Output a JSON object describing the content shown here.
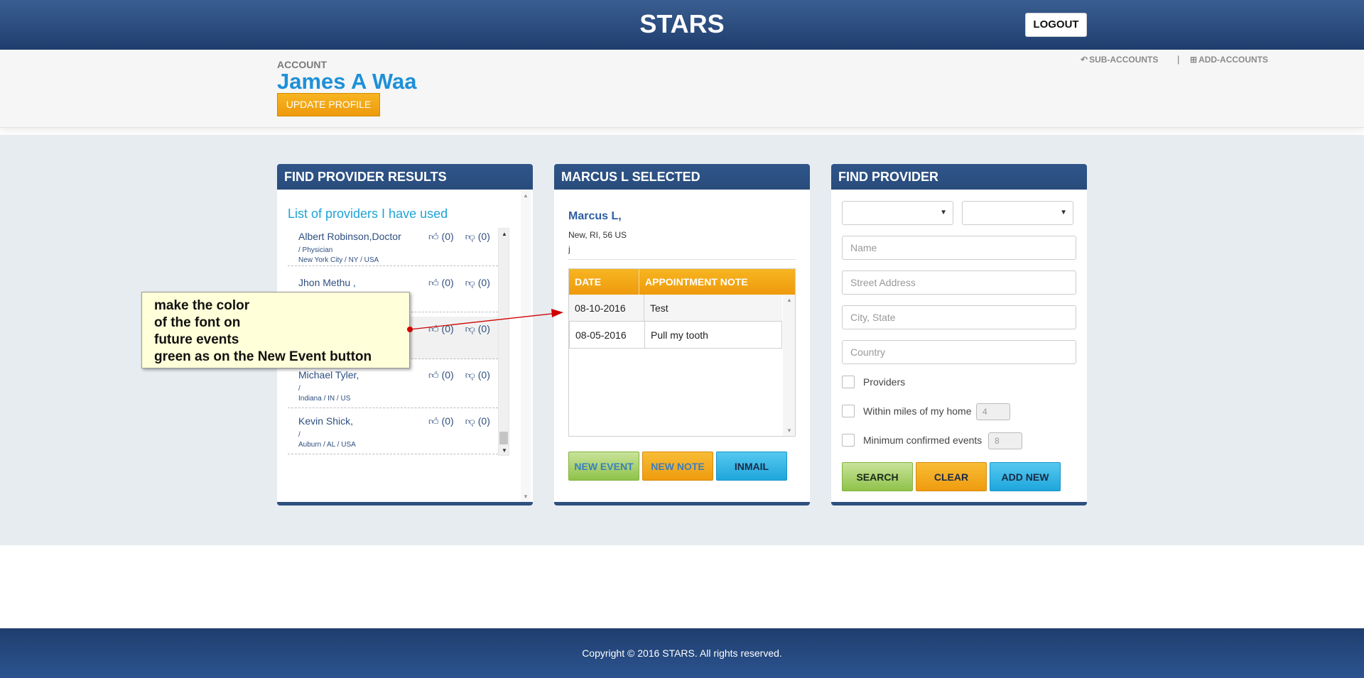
{
  "header": {
    "title": "STARS",
    "logout_label": "LOGOUT"
  },
  "account": {
    "label": "ACCOUNT",
    "name": "James A Waa",
    "update_profile_label": "UPDATE PROFILE",
    "sub_accounts_label": "SUB-ACCOUNTS",
    "separator": "|",
    "add_accounts_label": "ADD-ACCOUNTS"
  },
  "results_panel": {
    "title": "FIND PROVIDER RESULTS",
    "subtitle": "List of providers I have used",
    "providers": [
      {
        "name": "Albert Robinson,Doctor",
        "up": "(0)",
        "down": "(0)",
        "specialty": "/ Physician",
        "location": "New York City / NY / USA"
      },
      {
        "name": "Jhon Methu ,",
        "up": "(0)",
        "down": "(0)",
        "specialty": "",
        "location": ""
      },
      {
        "name": "",
        "up": "(0)",
        "down": "(0)",
        "specialty": "",
        "location": ""
      },
      {
        "name": "Michael Tyler,",
        "up": "(0)",
        "down": "(0)",
        "specialty": "/",
        "location": "Indiana / IN / US"
      },
      {
        "name": "Kevin Shick,",
        "up": "(0)",
        "down": "(0)",
        "specialty": "/",
        "location": "Auburn / AL / USA"
      }
    ]
  },
  "selected_panel": {
    "title": "MARCUS L SELECTED",
    "name": "Marcus L,",
    "address": "New, RI, 56 US",
    "extra": "j",
    "columns": [
      "DATE",
      "APPOINTMENT NOTE"
    ],
    "appointments": [
      {
        "date": "08-10-2016",
        "note": "Test"
      },
      {
        "date": "08-05-2016",
        "note": "Pull my tooth"
      }
    ],
    "new_event_label": "NEW EVENT",
    "new_note_label": "NEW NOTE",
    "inmail_label": "INMAIL"
  },
  "find_panel": {
    "title": "FIND PROVIDER",
    "select_1_value": "",
    "select_2_value": "",
    "name_placeholder": "Name",
    "street_placeholder": "Street Address",
    "city_placeholder": "City, State",
    "country_placeholder": "Country",
    "providers_label": "Providers",
    "providers_checked": false,
    "miles_label": "Within miles of my home",
    "miles_value": "4",
    "min_events_label": "Minimum confirmed events",
    "min_events_value": "8",
    "search_label": "SEARCH",
    "clear_label": "CLEAR",
    "add_new_label": "ADD NEW"
  },
  "annotation": {
    "lines": [
      "make the color",
      "of the font on",
      "future events",
      "green as on the New Event button"
    ]
  },
  "footer": {
    "copyright": "Copyright © 2016 STARS. All rights reserved."
  },
  "colors": {
    "header_blue": "#2f5589",
    "accent_blue": "#1e90d8",
    "orange": "#f0a012",
    "green": "#8fc24a",
    "cyan": "#1ea6dc",
    "annotation_red": "#d00000"
  },
  "icons": {
    "thumbs_up": "thumbs-up-icon",
    "thumbs_down": "thumbs-down-icon",
    "reply": "reply-icon",
    "plus_square": "plus-square-icon",
    "dropdown": "caret-down-icon"
  }
}
